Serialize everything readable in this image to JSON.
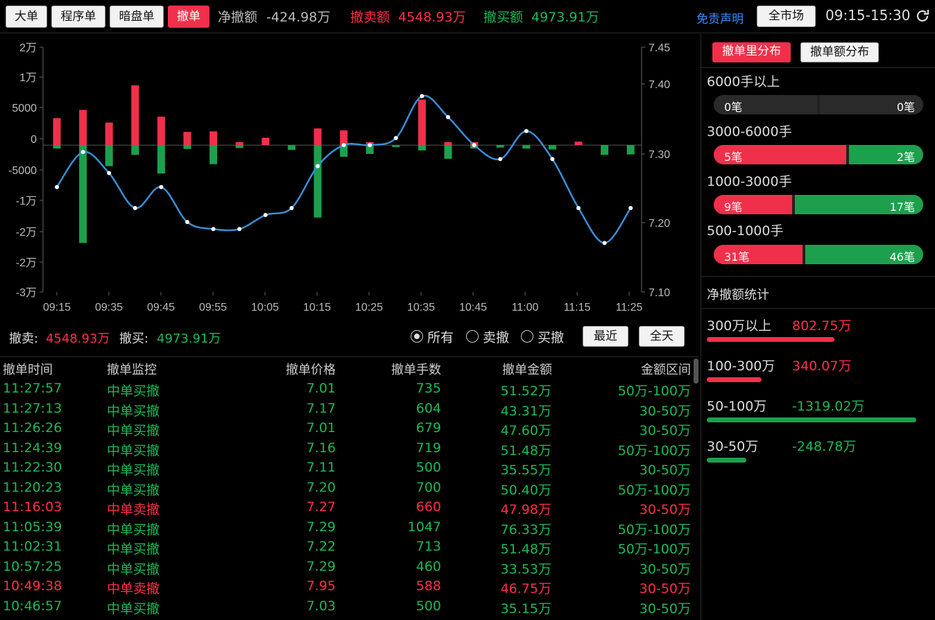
{
  "toolbar": {
    "tabs": [
      {
        "label": "大单",
        "active": false
      },
      {
        "label": "程序单",
        "active": false
      },
      {
        "label": "暗盘单",
        "active": false
      },
      {
        "label": "撤单",
        "active": true
      }
    ],
    "net_cancel_label": "净撤额",
    "net_cancel_value": "-424.98万",
    "sell_cancel_label": "撤卖额",
    "sell_cancel_value": "4548.93万",
    "buy_cancel_label": "撤买额",
    "buy_cancel_value": "4973.91万",
    "disclaimer": "免责声明",
    "market_button": "全市场",
    "time_range": "09:15-15:30",
    "refresh_icon": "refresh-icon"
  },
  "chart_data": {
    "type": "bar",
    "x_ticks": [
      "09:15",
      "09:35",
      "09:45",
      "09:55",
      "10:05",
      "10:15",
      "10:25",
      "10:35",
      "10:45",
      "11:00",
      "11:15",
      "11:25"
    ],
    "y_left_ticks": [
      "2万",
      "1万",
      "5000",
      "0",
      "-5000",
      "-1万",
      "-1.5万",
      "-2万",
      "-2.5万",
      "-3万"
    ],
    "y_left_values": [
      20000,
      10000,
      5000,
      0,
      -5000,
      -10000,
      -15000,
      -20000,
      -25000,
      -30000
    ],
    "y_left_tick_labels_shown": [
      "2万",
      "1万",
      "5000",
      "0",
      "-5000",
      "-1万",
      "-2万",
      "-2万",
      "-3万"
    ],
    "y_left_range": [
      -30000,
      20000
    ],
    "y_right_ticks": [
      "7.45",
      "7.40",
      "7.30",
      "7.20",
      "7.10"
    ],
    "y_right_range": [
      7.1,
      7.45
    ],
    "sell_cancel_color": "#f0304a",
    "buy_cancel_color": "#1da04d",
    "price_line_color": "#3a8fd6",
    "series": [
      {
        "name": "撤卖",
        "values": [
          5500,
          7200,
          4600,
          12200,
          5800,
          2700,
          2800,
          600,
          1500,
          0,
          3400,
          3000,
          600,
          0,
          9300,
          600,
          600,
          0,
          0,
          0,
          700,
          0,
          0
        ]
      },
      {
        "name": "撤买",
        "values": [
          -700,
          -20000,
          -4300,
          -2000,
          -5800,
          -800,
          -3900,
          -600,
          0,
          -1000,
          -14800,
          -2400,
          -1800,
          -400,
          -1100,
          -2800,
          -700,
          -500,
          -700,
          -900,
          0,
          -2000,
          -1900
        ]
      },
      {
        "name": "价格",
        "values": [
          7.25,
          7.3,
          7.27,
          7.22,
          7.25,
          7.2,
          7.19,
          7.19,
          7.21,
          7.22,
          7.28,
          7.31,
          7.31,
          7.32,
          7.38,
          7.35,
          7.31,
          7.29,
          7.33,
          7.29,
          7.22,
          7.17,
          7.22
        ]
      }
    ],
    "grid": false
  },
  "chart_footer": {
    "sell_label": "撤卖:",
    "sell_value": "4548.93万",
    "buy_label": "撤买:",
    "buy_value": "4973.91万",
    "filters": [
      {
        "label": "所有",
        "selected": true
      },
      {
        "label": "卖撤",
        "selected": false
      },
      {
        "label": "买撤",
        "selected": false
      }
    ],
    "recent_button": "最近",
    "allday_button": "全天"
  },
  "table": {
    "headers": [
      "撤单时间",
      "撤单监控",
      "撤单价格",
      "撤单手数",
      "撤单金额",
      "金额区间"
    ],
    "rows": [
      {
        "time": "11:27:57",
        "type": "中单买撤",
        "price": "7.01",
        "lots": "735",
        "amount": "51.52万",
        "range": "50万-100万",
        "side": "buy"
      },
      {
        "time": "11:27:13",
        "type": "中单买撤",
        "price": "7.17",
        "lots": "604",
        "amount": "43.31万",
        "range": "30-50万",
        "side": "buy"
      },
      {
        "time": "11:26:26",
        "type": "中单买撤",
        "price": "7.01",
        "lots": "679",
        "amount": "47.60万",
        "range": "30-50万",
        "side": "buy"
      },
      {
        "time": "11:24:39",
        "type": "中单买撤",
        "price": "7.16",
        "lots": "719",
        "amount": "51.48万",
        "range": "50万-100万",
        "side": "buy"
      },
      {
        "time": "11:22:30",
        "type": "中单买撤",
        "price": "7.11",
        "lots": "500",
        "amount": "35.55万",
        "range": "30-50万",
        "side": "buy"
      },
      {
        "time": "11:20:23",
        "type": "中单买撤",
        "price": "7.20",
        "lots": "700",
        "amount": "50.40万",
        "range": "50万-100万",
        "side": "buy"
      },
      {
        "time": "11:16:03",
        "type": "中单卖撤",
        "price": "7.27",
        "lots": "660",
        "amount": "47.98万",
        "range": "30-50万",
        "side": "sell"
      },
      {
        "time": "11:05:39",
        "type": "中单买撤",
        "price": "7.29",
        "lots": "1047",
        "amount": "76.33万",
        "range": "50万-100万",
        "side": "buy"
      },
      {
        "time": "11:02:31",
        "type": "中单买撤",
        "price": "7.22",
        "lots": "713",
        "amount": "51.48万",
        "range": "50万-100万",
        "side": "buy"
      },
      {
        "time": "10:57:25",
        "type": "中单买撤",
        "price": "7.29",
        "lots": "460",
        "amount": "33.53万",
        "range": "30-50万",
        "side": "buy"
      },
      {
        "time": "10:49:38",
        "type": "中单卖撤",
        "price": "7.95",
        "lots": "588",
        "amount": "46.75万",
        "range": "30-50万",
        "side": "sell"
      },
      {
        "time": "10:46:57",
        "type": "中单买撤",
        "price": "7.03",
        "lots": "500",
        "amount": "35.15万",
        "range": "30-50万",
        "side": "buy"
      }
    ]
  },
  "right_panel": {
    "tabs": [
      {
        "label": "撤单里分布",
        "active": true
      },
      {
        "label": "撤单额分布",
        "active": false
      }
    ],
    "distributions": [
      {
        "label": "6000手以上",
        "left": "0笔",
        "right": "0笔",
        "left_share": 0.5,
        "empty": true
      },
      {
        "label": "3000-6000手",
        "left": "5笔",
        "right": "2笔",
        "left_share": 0.64,
        "empty": false
      },
      {
        "label": "1000-3000手",
        "left": "9笔",
        "right": "17笔",
        "left_share": 0.38,
        "empty": false
      },
      {
        "label": "500-1000手",
        "left": "31笔",
        "right": "46笔",
        "left_share": 0.43,
        "empty": false
      }
    ],
    "net_title": "净撤额统计",
    "net_stats": [
      {
        "label": "300万以上",
        "value": "802.75万",
        "side": "sell",
        "share": 0.61
      },
      {
        "label": "100-300万",
        "value": "340.07万",
        "side": "sell",
        "share": 0.26
      },
      {
        "label": "50-100万",
        "value": "-1319.02万",
        "side": "buy",
        "share": 1.0
      },
      {
        "label": "30-50万",
        "value": "-248.78万",
        "side": "buy",
        "share": 0.19
      }
    ]
  }
}
